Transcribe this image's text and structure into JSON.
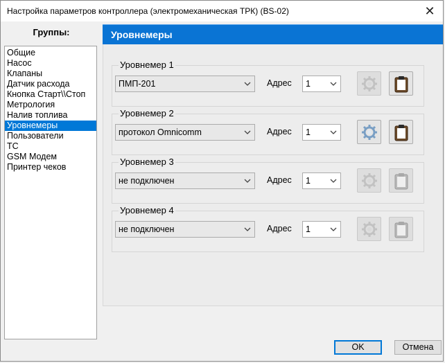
{
  "window": {
    "title": "Настройка параметров контроллера (электромеханическая ТРК) (BS-02)",
    "close_glyph": "✕"
  },
  "groups": {
    "header": "Группы:",
    "items": [
      "Общие",
      "Насос",
      "Клапаны",
      "Датчик расхода",
      "Кнопка Старт\\\\Стоп",
      "Метрология",
      "Налив топлива",
      "Уровнемеры",
      "Пользователи",
      "ТС",
      "GSM Модем",
      "Принтер чеков"
    ],
    "selected_index": 7
  },
  "panel": {
    "title": "Уровнемеры",
    "address_label": "Адрес",
    "gauges": [
      {
        "title": "Уровнемер 1",
        "protocol": "ПМП-201",
        "address": "1",
        "settings_enabled": false,
        "clipboard_enabled": true
      },
      {
        "title": "Уровнемер 2",
        "protocol": "протокол Omnicomm",
        "address": "1",
        "settings_enabled": true,
        "clipboard_enabled": true
      },
      {
        "title": "Уровнемер 3",
        "protocol": "не подключен",
        "address": "1",
        "settings_enabled": false,
        "clipboard_enabled": false
      },
      {
        "title": "Уровнемер 4",
        "protocol": "не подключен",
        "address": "1",
        "settings_enabled": false,
        "clipboard_enabled": false
      }
    ]
  },
  "footer": {
    "ok_label": "OK",
    "cancel_label": "Отмена"
  },
  "icons": {
    "settings": "gear-icon",
    "clipboard": "clipboard-icon",
    "dropdown": "chevron-down-icon"
  },
  "colors": {
    "accent": "#0a74d4",
    "selection": "#0078d7"
  }
}
